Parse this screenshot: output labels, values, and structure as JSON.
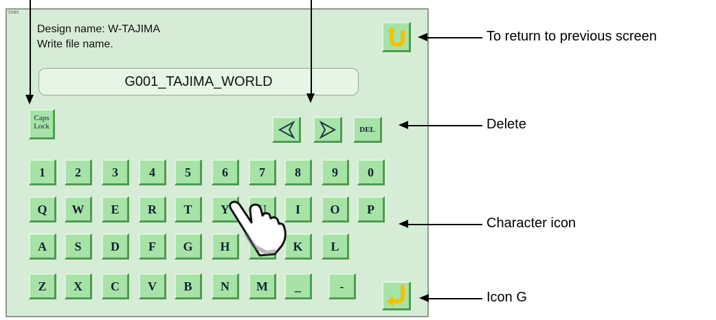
{
  "screen": {
    "corner_tag": "5080",
    "design_name": "Design name: W-TAJIMA",
    "instruction": "Write file name.",
    "file_name_value": "G001_TAJIMA_WORLD",
    "caps_lock_label": [
      "Caps",
      "Lock"
    ],
    "del_label": "DEL",
    "keys_row1": [
      "1",
      "2",
      "3",
      "4",
      "5",
      "6",
      "7",
      "8",
      "9",
      "0"
    ],
    "keys_row2": [
      "Q",
      "W",
      "E",
      "R",
      "T",
      "Y",
      "U",
      "I",
      "O",
      "P"
    ],
    "keys_row3": [
      "A",
      "S",
      "D",
      "F",
      "G",
      "H",
      "J",
      "K",
      "L"
    ],
    "keys_row4": [
      "Z",
      "X",
      "C",
      "V",
      "B",
      "N",
      "M",
      "_",
      "-"
    ],
    "colors": {
      "panel": "#d7ecd7",
      "key": "#a7e3a7",
      "accent_arrow": "#f2c200"
    },
    "icons": [
      "return-icon",
      "left-arrow-icon",
      "right-arrow-icon",
      "enter-icon",
      "hand-pointer-icon"
    ]
  },
  "annotations": {
    "return": "To return to previous screen",
    "delete": "Delete",
    "character": "Character icon",
    "icon_g": "Icon G"
  }
}
